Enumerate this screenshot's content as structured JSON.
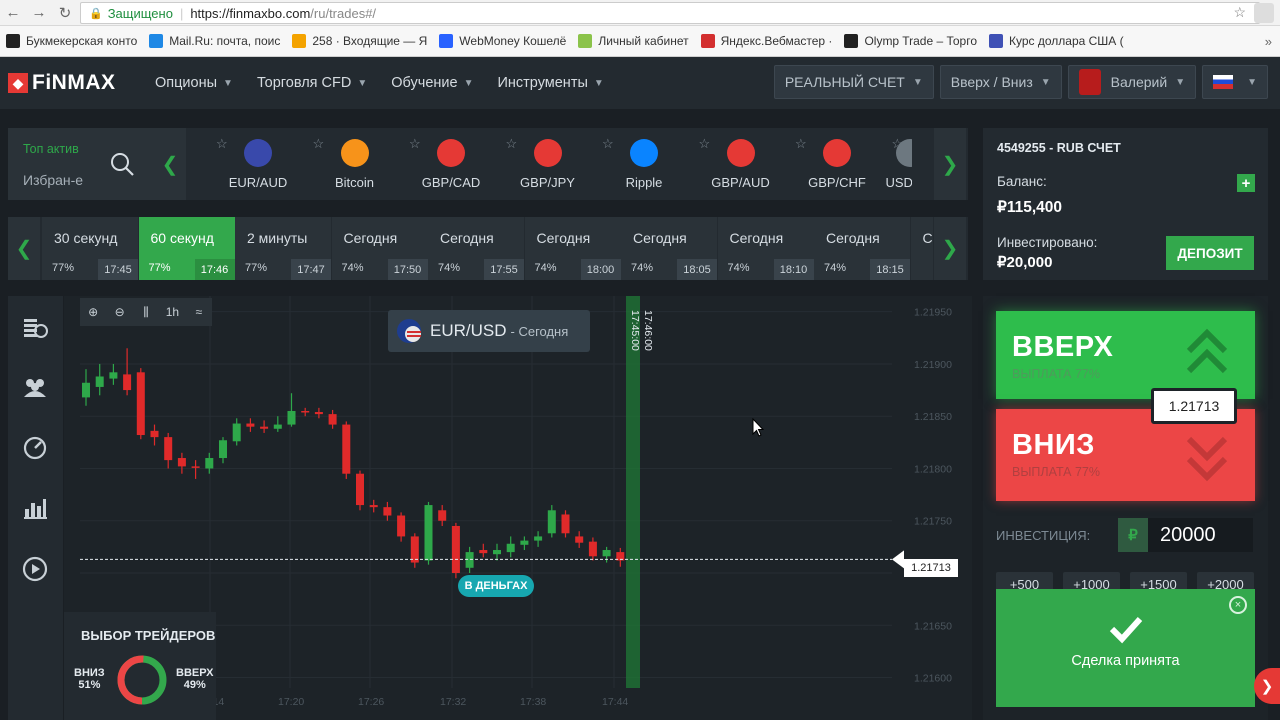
{
  "browser": {
    "secure_label": "Защищено",
    "url_host": "https://finmaxbo.com",
    "url_path": "/ru/trades#/",
    "bookmarks": [
      {
        "label": "Букмекерская конто",
        "color": "#222222"
      },
      {
        "label": "Mail.Ru: почта, поис",
        "color": "#1e88e5"
      },
      {
        "label": "258 · Входящие — Я",
        "color": "#f4a300"
      },
      {
        "label": "WebMoney Кошелё",
        "color": "#2962ff"
      },
      {
        "label": "Личный кабинет",
        "color": "#8bc34a"
      },
      {
        "label": "Яндекс.Вебмастер ·",
        "color": "#d32f2f"
      },
      {
        "label": "Olymp Trade – Торго",
        "color": "#212121"
      },
      {
        "label": "Курс доллара США (",
        "color": "#3f51b5"
      }
    ]
  },
  "header": {
    "logo": "FiNMAX",
    "nav": [
      "Опционы",
      "Торговля CFD",
      "Обучение",
      "Инструменты"
    ],
    "account_type": "РЕАЛЬНЫЙ СЧЕТ",
    "option_type": "Вверх / Вниз",
    "user": "Валерий"
  },
  "assets": {
    "top_label": "Топ актив",
    "favorites": "Избран-е",
    "items": [
      {
        "name": "EUR/AUD",
        "color": "#3949ab"
      },
      {
        "name": "Bitcoin",
        "color": "#f7931a"
      },
      {
        "name": "GBP/CAD",
        "color": "#e53935"
      },
      {
        "name": "GBP/JPY",
        "color": "#e53935"
      },
      {
        "name": "Ripple",
        "color": "#0a84ff"
      },
      {
        "name": "GBP/AUD",
        "color": "#e53935"
      },
      {
        "name": "GBP/CHF",
        "color": "#e53935"
      },
      {
        "name": "USD",
        "color": "#6d7880"
      }
    ]
  },
  "expiries": [
    {
      "label": "30 секунд",
      "pct": "77%",
      "time": "17:45",
      "active": false
    },
    {
      "label": "60 секунд",
      "pct": "77%",
      "time": "17:46",
      "active": true
    },
    {
      "label": "2 минуты",
      "pct": "77%",
      "time": "17:47",
      "active": false
    },
    {
      "label": "Сегодня",
      "pct": "74%",
      "time": "17:50",
      "active": false
    },
    {
      "label": "Сегодня",
      "pct": "74%",
      "time": "17:55",
      "active": false
    },
    {
      "label": "Сегодня",
      "pct": "74%",
      "time": "18:00",
      "active": false
    },
    {
      "label": "Сегодня",
      "pct": "74%",
      "time": "18:05",
      "active": false
    },
    {
      "label": "Сегодня",
      "pct": "74%",
      "time": "18:10",
      "active": false
    },
    {
      "label": "Сегодня",
      "pct": "74%",
      "time": "18:15",
      "active": false
    },
    {
      "label": "С",
      "pct": "",
      "time": "",
      "active": false
    }
  ],
  "chart": {
    "pair": "EUR/USD",
    "period": "- Сегодня",
    "timeframe": "1h",
    "expiry_marker": "17:46:00",
    "entry_marker": "17:45:00",
    "in_money": "В ДЕНЬГАХ",
    "current_price": "1.21713"
  },
  "chart_data": {
    "type": "candlestick",
    "title": "EUR/USD - Сегодня",
    "y_ticks": [
      "1.21950",
      "1.21900",
      "1.21850",
      "1.21800",
      "1.21750",
      "1.21700",
      "1.21650",
      "1.21600"
    ],
    "x_ticks": [
      "17:14",
      "17:20",
      "17:26",
      "17:32",
      "17:38",
      "17:44"
    ],
    "ylim": [
      1.2159,
      1.21965
    ],
    "current": 1.21713,
    "candles": [
      {
        "o": 1.21868,
        "c": 1.21882,
        "h": 1.21895,
        "l": 1.2186
      },
      {
        "o": 1.21878,
        "c": 1.21888,
        "h": 1.219,
        "l": 1.2187
      },
      {
        "o": 1.21886,
        "c": 1.21892,
        "h": 1.219,
        "l": 1.2188
      },
      {
        "o": 1.2189,
        "c": 1.21875,
        "h": 1.21915,
        "l": 1.2187
      },
      {
        "o": 1.21892,
        "c": 1.21832,
        "h": 1.21896,
        "l": 1.21828
      },
      {
        "o": 1.21836,
        "c": 1.2183,
        "h": 1.21842,
        "l": 1.21822
      },
      {
        "o": 1.2183,
        "c": 1.21808,
        "h": 1.21834,
        "l": 1.218
      },
      {
        "o": 1.2181,
        "c": 1.21802,
        "h": 1.21815,
        "l": 1.21795
      },
      {
        "o": 1.21802,
        "c": 1.21801,
        "h": 1.21808,
        "l": 1.2179
      },
      {
        "o": 1.218,
        "c": 1.2181,
        "h": 1.21815,
        "l": 1.21795
      },
      {
        "o": 1.2181,
        "c": 1.21827,
        "h": 1.2183,
        "l": 1.21805
      },
      {
        "o": 1.21826,
        "c": 1.21843,
        "h": 1.21848,
        "l": 1.21822
      },
      {
        "o": 1.21843,
        "c": 1.2184,
        "h": 1.21848,
        "l": 1.21835
      },
      {
        "o": 1.2184,
        "c": 1.21838,
        "h": 1.21846,
        "l": 1.21834
      },
      {
        "o": 1.21838,
        "c": 1.21842,
        "h": 1.2185,
        "l": 1.21835
      },
      {
        "o": 1.21842,
        "c": 1.21855,
        "h": 1.21872,
        "l": 1.2184
      },
      {
        "o": 1.21855,
        "c": 1.21854,
        "h": 1.21858,
        "l": 1.2185
      },
      {
        "o": 1.21854,
        "c": 1.21852,
        "h": 1.21858,
        "l": 1.21848
      },
      {
        "o": 1.21852,
        "c": 1.21842,
        "h": 1.21856,
        "l": 1.21838
      },
      {
        "o": 1.21842,
        "c": 1.21795,
        "h": 1.21845,
        "l": 1.2179
      },
      {
        "o": 1.21795,
        "c": 1.21765,
        "h": 1.21798,
        "l": 1.2176
      },
      {
        "o": 1.21765,
        "c": 1.21763,
        "h": 1.2177,
        "l": 1.21758
      },
      {
        "o": 1.21763,
        "c": 1.21755,
        "h": 1.21768,
        "l": 1.2175
      },
      {
        "o": 1.21755,
        "c": 1.21735,
        "h": 1.21758,
        "l": 1.2173
      },
      {
        "o": 1.21735,
        "c": 1.2171,
        "h": 1.21738,
        "l": 1.21705
      },
      {
        "o": 1.21712,
        "c": 1.21765,
        "h": 1.21768,
        "l": 1.21708
      },
      {
        "o": 1.2176,
        "c": 1.2175,
        "h": 1.21765,
        "l": 1.21745
      },
      {
        "o": 1.21745,
        "c": 1.217,
        "h": 1.21748,
        "l": 1.21695
      },
      {
        "o": 1.21705,
        "c": 1.2172,
        "h": 1.21725,
        "l": 1.217
      },
      {
        "o": 1.21722,
        "c": 1.21719,
        "h": 1.21728,
        "l": 1.21715
      },
      {
        "o": 1.21718,
        "c": 1.21722,
        "h": 1.21728,
        "l": 1.21712
      },
      {
        "o": 1.2172,
        "c": 1.21728,
        "h": 1.21735,
        "l": 1.21715
      },
      {
        "o": 1.21727,
        "c": 1.21731,
        "h": 1.21735,
        "l": 1.21722
      },
      {
        "o": 1.21731,
        "c": 1.21735,
        "h": 1.2174,
        "l": 1.21725
      },
      {
        "o": 1.21738,
        "c": 1.2176,
        "h": 1.21765,
        "l": 1.21734
      },
      {
        "o": 1.21756,
        "c": 1.21738,
        "h": 1.2176,
        "l": 1.21734
      },
      {
        "o": 1.21735,
        "c": 1.21729,
        "h": 1.2174,
        "l": 1.21724
      },
      {
        "o": 1.2173,
        "c": 1.21716,
        "h": 1.21734,
        "l": 1.21712
      },
      {
        "o": 1.21716,
        "c": 1.21722,
        "h": 1.21725,
        "l": 1.2171
      },
      {
        "o": 1.2172,
        "c": 1.21712,
        "h": 1.21724,
        "l": 1.21706
      }
    ],
    "up_color": "#2ea84a",
    "down_color": "#e02a2a"
  },
  "traders": {
    "title": "ВЫБОР ТРЕЙДЕРОВ",
    "down_label": "ВНИЗ",
    "down_pct": "51%",
    "up_label": "ВВЕРХ",
    "up_pct": "49%",
    "down_share": 0.51
  },
  "account": {
    "number": "4549255 - RUB СЧЕТ",
    "balance_label": "Баланс:",
    "balance": "₽115,400",
    "invested_label": "Инвестировано:",
    "invested": "₽20,000",
    "deposit": "ДЕПОЗИТ"
  },
  "trade": {
    "up": "ВВЕРХ",
    "up_payout": "ВЫПЛАТА 77%",
    "down": "ВНИЗ",
    "down_payout": "ВЫПЛАТА 77%",
    "price": "1.21713",
    "investment_label": "ИНВЕСТИЦИЯ:",
    "currency": "₽",
    "amount": "20000",
    "quick": [
      "+500",
      "+1000",
      "+1500",
      "+2000"
    ],
    "accepted": "Сделка принята",
    "close": "×"
  },
  "colors": {
    "accent_green": "#33a84c",
    "accent_red": "#ec4646",
    "bg": "#1d2328"
  }
}
